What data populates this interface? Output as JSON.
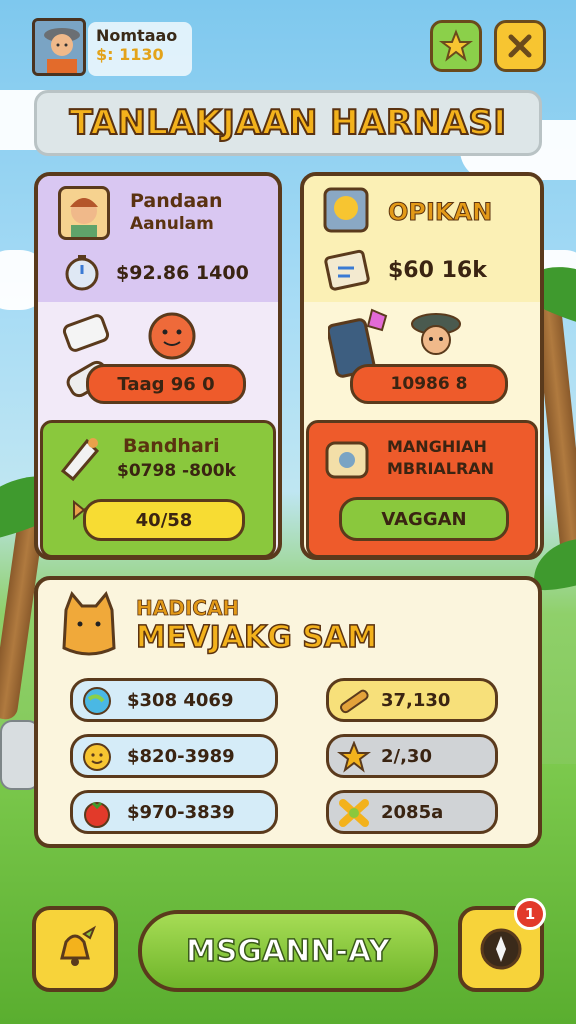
{
  "player": {
    "name": "Nomtaao",
    "money": "$: 1130"
  },
  "title": "TANLAKJAAN HARNASI",
  "panels": {
    "left_top": {
      "name_line1": "Pandaan",
      "name_line2": "Aanulam",
      "stat": "$92.86 1400",
      "action": "Taag 96 0"
    },
    "left_bottom": {
      "label": "Bandhari",
      "stat": "$0798 -800k",
      "action": "40/58"
    },
    "right_top": {
      "label": "OPIKAN",
      "stat": "$60 16k",
      "action": "10986 8"
    },
    "right_bottom": {
      "label_line1": "MANGHIAH",
      "label_line2": "MBRIALRAN",
      "action": "VAGGAN"
    }
  },
  "reward": {
    "subtitle": "HADICAH",
    "title": "MEVJAKG SAM",
    "left_items": [
      {
        "icon": "globe-gem-icon",
        "value": "$308 4069"
      },
      {
        "icon": "smiley-coin-icon",
        "value": "$820-3989"
      },
      {
        "icon": "tomato-icon",
        "value": "$970-3839"
      }
    ],
    "right_items": [
      {
        "icon": "wood-log-icon",
        "value": "37,130"
      },
      {
        "icon": "gold-star-icon",
        "value": "2/,30"
      },
      {
        "icon": "cross-star-icon",
        "value": "2085a"
      }
    ]
  },
  "bottom": {
    "main_button": "MSGANN-AY",
    "notification_badge": "1"
  },
  "colors": {
    "purple": "#d9c7f2",
    "yellow": "#fbf0b5",
    "green": "#8ac83d",
    "red": "#ee5b2b",
    "cream": "#fbf5dd",
    "gold": "#f3b21c"
  }
}
